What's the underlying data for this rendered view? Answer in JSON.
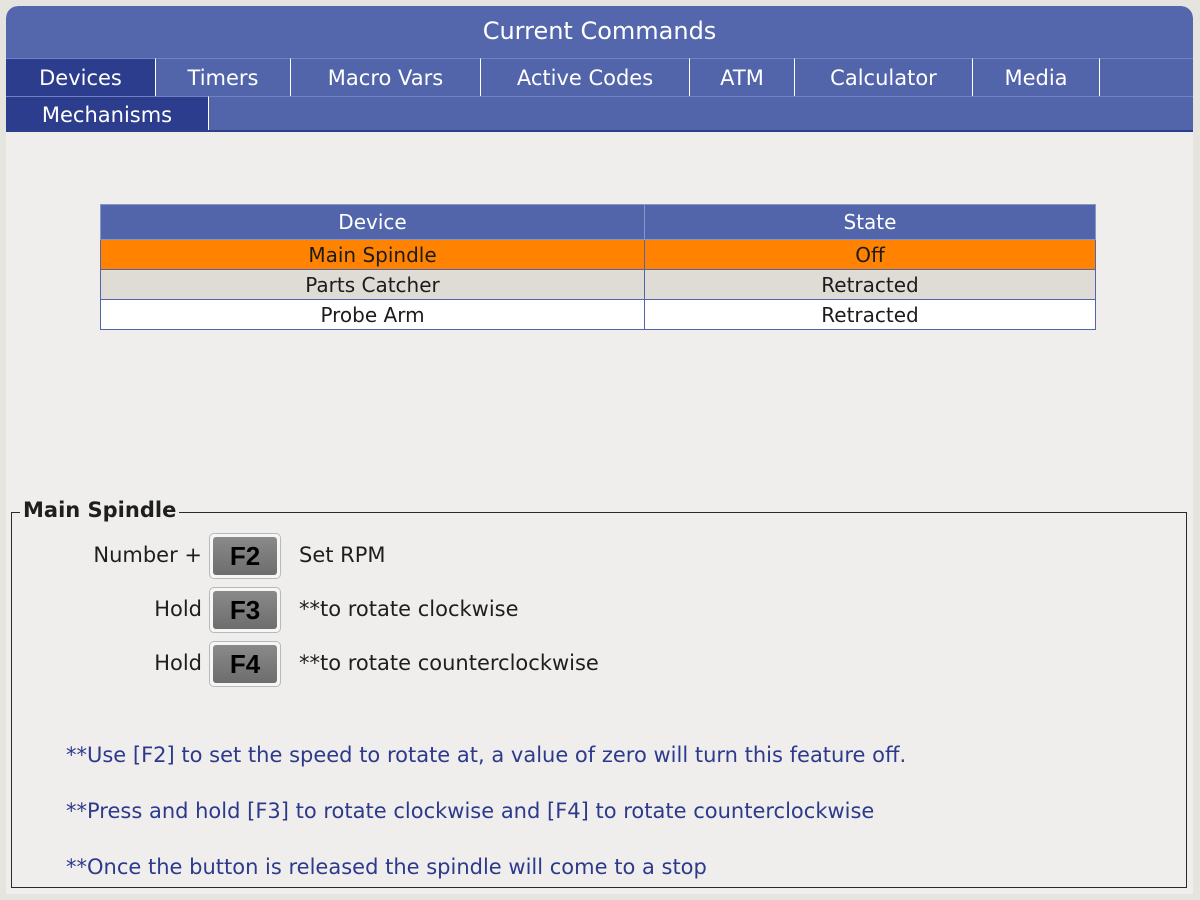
{
  "window": {
    "title": "Current Commands"
  },
  "tabs": {
    "row1": [
      {
        "label": "Devices",
        "active": true
      },
      {
        "label": "Timers",
        "active": false
      },
      {
        "label": "Macro Vars",
        "active": false
      },
      {
        "label": "Active Codes",
        "active": false
      },
      {
        "label": "ATM",
        "active": false
      },
      {
        "label": "Calculator",
        "active": false
      },
      {
        "label": "Media",
        "active": false
      }
    ],
    "row2": [
      {
        "label": "Mechanisms",
        "active": true
      }
    ]
  },
  "devices_table": {
    "headers": [
      "Device",
      "State"
    ],
    "rows": [
      {
        "device": "Main Spindle",
        "state": "Off",
        "selected": true
      },
      {
        "device": "Parts Catcher",
        "state": "Retracted",
        "selected": false
      },
      {
        "device": "Probe Arm",
        "state": "Retracted",
        "selected": false
      }
    ]
  },
  "panel": {
    "title": "Main Spindle",
    "keys": [
      {
        "prefix": "Number +",
        "key": "F2",
        "description": "Set RPM"
      },
      {
        "prefix": "Hold",
        "key": "F3",
        "description": "**to rotate clockwise"
      },
      {
        "prefix": "Hold",
        "key": "F4",
        "description": "**to rotate counterclockwise"
      }
    ],
    "notes": [
      "**Use [F2] to set the speed to rotate at, a value of zero will turn this feature off.",
      "**Press and hold [F3] to rotate clockwise and [F4] to rotate counterclockwise",
      "**Once the button is released the spindle will come to a stop"
    ]
  },
  "colors": {
    "header_blue": "#5265ab",
    "active_tab": "#2c3d8e",
    "selected_row": "#ff8200",
    "alt_row": "#dfdcd6",
    "note_text": "#2d3a8c"
  }
}
